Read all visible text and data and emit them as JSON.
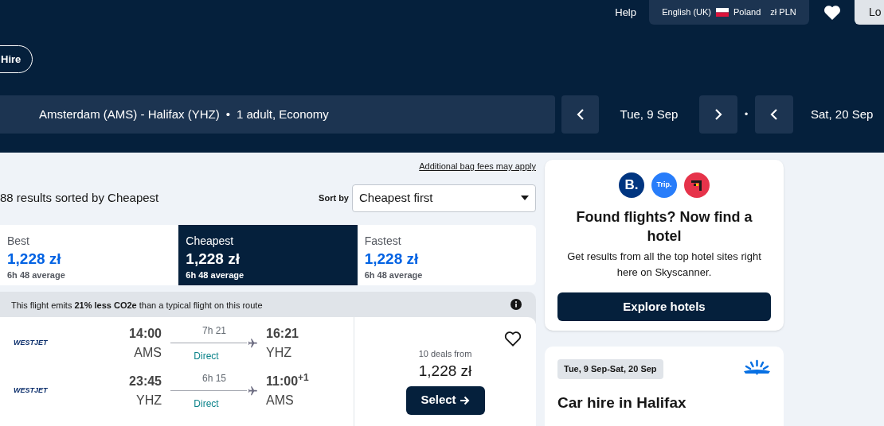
{
  "top_nav": {
    "help": "Help",
    "language": "English (UK)",
    "country": "Poland",
    "currency": "zł PLN",
    "login": "Lo"
  },
  "nav_pill": "Hire",
  "search": {
    "route": "Amsterdam (AMS) - Halifax (YHZ)",
    "separator": "•",
    "date_separator": "•",
    "travellers": "1 adult, Economy",
    "depart": "Tue, 9 Sep",
    "return": "Sat, 20 Sep"
  },
  "bag_fees_link": "Additional bag fees may apply",
  "results_summary": "88 results sorted by Cheapest",
  "sort": {
    "label": "Sort by",
    "value": "Cheapest first"
  },
  "sort_tabs": [
    {
      "label": "Best",
      "price": "1,228 zł",
      "duration": "6h 48 average",
      "selected": false
    },
    {
      "label": "Cheapest",
      "price": "1,228 zł",
      "duration": "6h 48 average",
      "selected": true
    },
    {
      "label": "Fastest",
      "price": "1,228 zł",
      "duration": "6h 48 average",
      "selected": false
    }
  ],
  "eco_banner": "This flight emits **21% less CO2e** than a typical flight on this route",
  "flight": {
    "legs": [
      {
        "airline": "WESTJET",
        "depart_time": "14:00",
        "depart_airport": "AMS",
        "duration": "7h 21",
        "stops": "Direct",
        "arrive_time": "16:21",
        "arrive_airport": "YHZ"
      },
      {
        "airline": "WESTJET",
        "depart_time": "23:45",
        "depart_airport": "YHZ",
        "duration": "6h 15",
        "stops": "Direct",
        "arrive_time": "11:00$^{+1}$",
        "arrive_airport": "AMS"
      }
    ],
    "deals": "10 deals from",
    "price": "1,228 zł",
    "button": "Select"
  },
  "hotel_card": {
    "logos": [
      "B.",
      "Trip."
    ],
    "title": "Found flights? Now find a hotel",
    "text": "Get results from all the top hotel sites right here on Skyscanner.",
    "button": "Explore hotels"
  },
  "car_card": {
    "dates": "Tue, 9 Sep-Sat, 20 Sep",
    "title": "Car hire in Halifax"
  }
}
